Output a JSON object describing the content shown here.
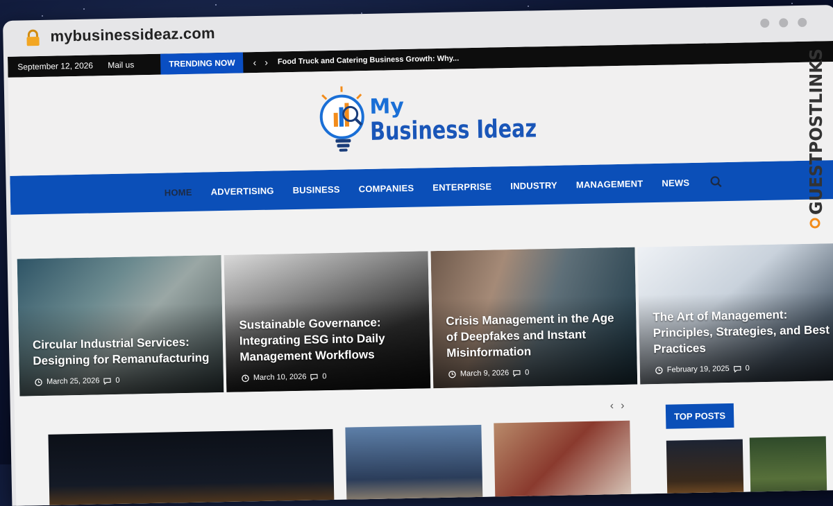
{
  "browser": {
    "url": "mybusinessideaz.com",
    "lock_icon": "lock-icon"
  },
  "topbar": {
    "date": "September 12, 2026",
    "mail_label": "Mail us",
    "trending_label": "TRENDING NOW",
    "trending_headline": "Food Truck and Catering Business Growth: Why..."
  },
  "logo": {
    "line1": "My",
    "line2": "Business Ideaz"
  },
  "nav": {
    "items": [
      "HOME",
      "ADVERTISING",
      "BUSINESS",
      "COMPANIES",
      "ENTERPRISE",
      "INDUSTRY",
      "MANAGEMENT",
      "NEWS"
    ]
  },
  "slides": [
    {
      "title": "Circular Industrial Services: Designing for Remanufacturing",
      "date": "March 25, 2026",
      "comments": "0"
    },
    {
      "title": "Sustainable Governance: Integrating ESG into Daily Management Workflows",
      "date": "March 10, 2026",
      "comments": "0"
    },
    {
      "title": "Crisis Management in the Age of Deepfakes and Instant Misinformation",
      "date": "March 9, 2026",
      "comments": "0"
    },
    {
      "title": "The Art of Management: Principles, Strategies, and Best Practices",
      "date": "February 19, 2025",
      "comments": "0"
    }
  ],
  "sidebar": {
    "top_posts_label": "TOP POSTS"
  },
  "watermark": {
    "text": "GUESTPOSTLINKS"
  },
  "colors": {
    "brand_blue": "#0b4fb8",
    "topbar": "#0d0d0d",
    "accent_orange": "#f28c1b"
  }
}
